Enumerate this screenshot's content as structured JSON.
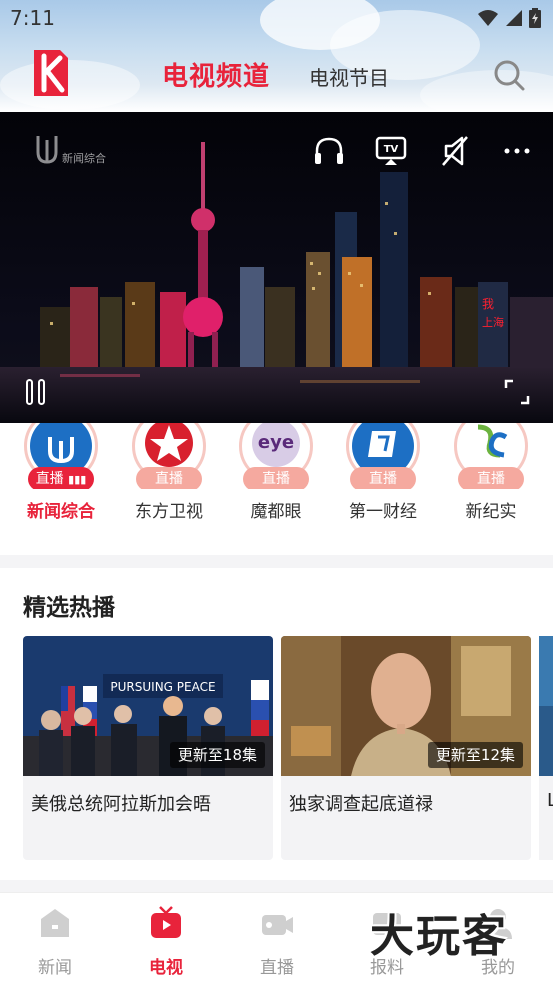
{
  "status_bar": {
    "time": "7:11"
  },
  "header": {
    "tab_tv_channels": "电视频道",
    "tab_tv_programs": "电视节目"
  },
  "player": {
    "channel_logo_text": "新闻综合"
  },
  "channels": [
    {
      "name": "新闻综合",
      "live": "直播",
      "active": true
    },
    {
      "name": "东方卫视",
      "live": "直播",
      "active": false
    },
    {
      "name": "魔都眼",
      "live": "直播",
      "active": false
    },
    {
      "name": "第一财经",
      "live": "直播",
      "active": false
    },
    {
      "name": "新纪实",
      "live": "直播",
      "active": false
    }
  ],
  "featured": {
    "title": "精选热播",
    "items": [
      {
        "title": "美俄总统阿拉斯加会晤",
        "badge": "更新至18集",
        "banner_text": "PURSUING PEACE"
      },
      {
        "title": "独家调查起底道禄",
        "badge": "更新至12集"
      },
      {
        "title": "L"
      }
    ]
  },
  "tabbar": {
    "items": [
      {
        "label": "新闻",
        "active": false
      },
      {
        "label": "电视",
        "active": true
      },
      {
        "label": "直播",
        "active": false
      },
      {
        "label": "报料",
        "active": false
      },
      {
        "label": "我的",
        "active": false
      }
    ]
  },
  "watermark": "大玩客",
  "colors": {
    "accent": "#e8233b",
    "live_inactive": "#f5a99f"
  }
}
